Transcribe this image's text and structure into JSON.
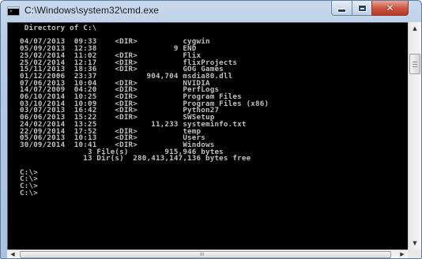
{
  "window": {
    "title": "C:\\Windows\\system32\\cmd.exe",
    "icon": "cmd-icon"
  },
  "controls": {
    "minimize_icon": "minimize-icon",
    "maximize_icon": "maximize-icon",
    "close_icon": "close-icon",
    "close_glyph": "✕"
  },
  "console": {
    "text": " Directory of C:\\\n\n04/07/2013  09:33    <DIR>          cygwin\n05/09/2013  12:38                 9 END\n25/02/2014  11:02    <DIR>          Flix\n25/02/2014  12:17    <DIR>          flixProjects\n15/11/2013  18:36    <DIR>          GOG Games\n01/12/2006  23:37           904,704 msdia80.dll\n07/06/2013  10:04    <DIR>          NVIDIA\n14/07/2009  04:20    <DIR>          PerfLogs\n06/10/2014  10:25    <DIR>          Program Files\n03/10/2014  10:09    <DIR>          Program Files (x86)\n03/07/2013  16:42    <DIR>          Python27\n06/06/2013  15:22    <DIR>          SWSetup\n24/02/2014  13:25            11,233 systeminfo.txt\n22/09/2014  17:52    <DIR>          temp\n05/06/2013  10:13    <DIR>          Users\n30/09/2014  10:41    <DIR>          Windows\n               3 File(s)        915,946 bytes\n              13 Dir(s)  280,413,147,136 bytes free\n\nC:\\>\nC:\\>\nC:\\>\nC:\\>"
  },
  "scrollbars": {
    "up_arrow": "▲",
    "down_arrow": "▼",
    "left_arrow": "◀",
    "right_arrow": "▶",
    "h_grip": "III"
  },
  "colors": {
    "console_background": "#000000",
    "console_text": "#c0c0c0",
    "close_button": "#c9523f"
  }
}
